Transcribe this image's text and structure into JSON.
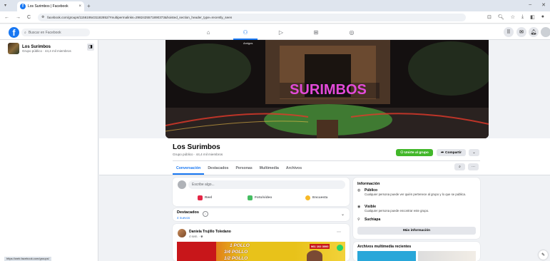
{
  "browser": {
    "tab_title": "Los Surimbos | Facebook",
    "tab_close": "×",
    "new_tab": "+",
    "url": "facebook.com/groups/1156195431182852/?multipermalinks=2982425571890373&hoisted_section_header_type=recently_seen",
    "nav": {
      "back": "←",
      "forward": "→",
      "reload": "C"
    },
    "window_controls": {
      "minimize": "–",
      "close": "✕"
    }
  },
  "facebook_header": {
    "logo": "f",
    "search_placeholder": "Buscar en Facebook",
    "nav_icons": [
      "home-icon",
      "groups-icon",
      "watch-icon",
      "marketplace-icon",
      "gaming-icon"
    ]
  },
  "sidebar": {
    "group_name": "Los Surimbos",
    "group_meta": "Grupo público · 44,4 mil miembros"
  },
  "group": {
    "cover_label": "Amigos",
    "cover_sign": "SURIMBOS",
    "name": "Los Surimbos",
    "meta": "Grupo público · 44,4 mil miembros",
    "join_label": "Unirte al grupo",
    "share_label": "Compartir",
    "tabs": [
      "Conversación",
      "Destacados",
      "Personas",
      "Multimedia",
      "Archivos"
    ]
  },
  "composer": {
    "placeholder": "Escribe algo...",
    "actions": [
      {
        "label": "Reel",
        "color": "#e42645"
      },
      {
        "label": "Foto/video",
        "color": "#45bd62"
      },
      {
        "label": "Encuesta",
        "color": "#f7b928"
      }
    ]
  },
  "featured": {
    "title": "Destacados",
    "subtitle": "4 nuevos"
  },
  "post": {
    "author": "Daniela Trujillo Toledano",
    "time": "4 sem. · ",
    "image_lines": [
      "1 POLLO",
      "3/4 POLLO",
      "1/2 POLLO"
    ],
    "phone": "961 102 3000"
  },
  "info": {
    "title": "Información",
    "items": [
      {
        "icon": "globe-icon",
        "head": "Público",
        "text": "Cualquier persona puede ver quién pertenece al grupo y lo que se publica."
      },
      {
        "icon": "eye-icon",
        "head": "Visible",
        "text": "Cualquier persona puede encontrar este grupo."
      },
      {
        "icon": "location-icon",
        "head": "Suchiapa",
        "text": ""
      }
    ],
    "more_label": "Más información"
  },
  "media": {
    "title": "Archivos multimedia recientes"
  },
  "status_url": "https://web.facebook.com/groups/"
}
